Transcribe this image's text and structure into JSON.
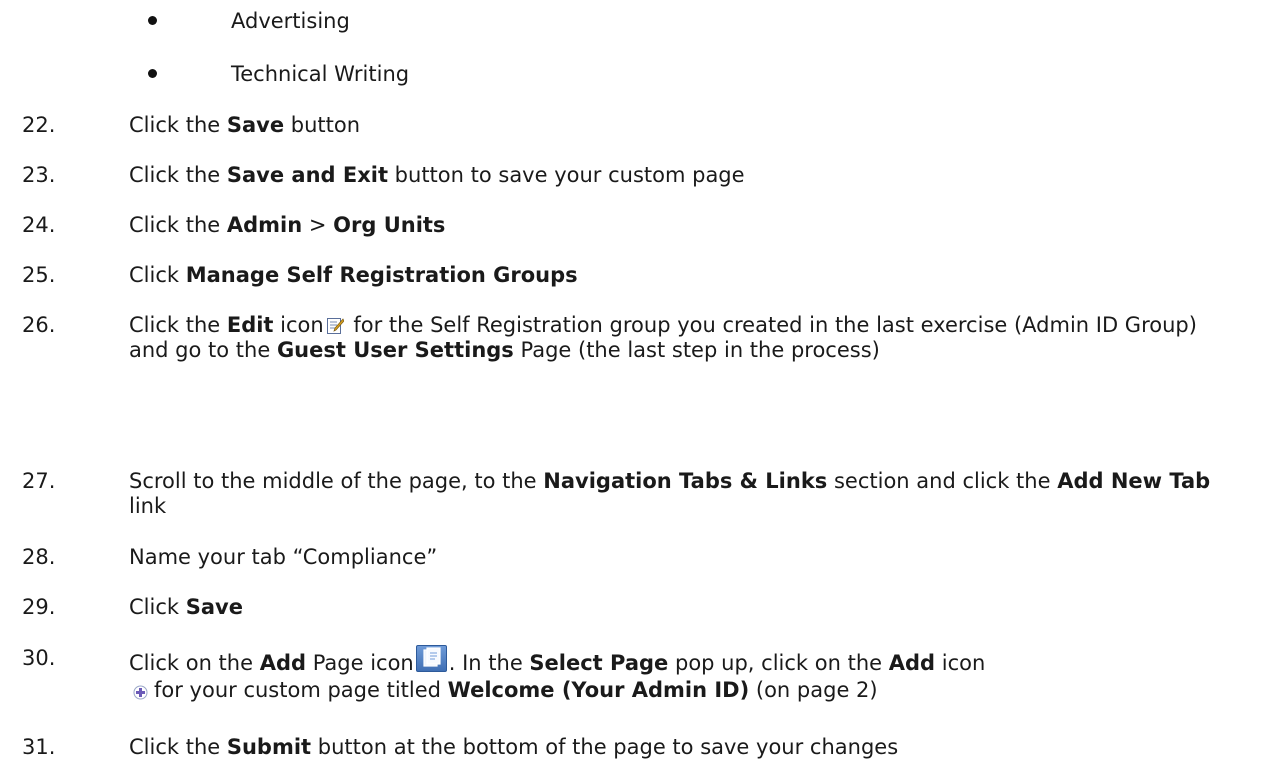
{
  "bullets": [
    "Advertising",
    "Technical Writing"
  ],
  "steps": [
    {
      "num": "22.",
      "p": [
        "Click the ",
        "Save",
        " button"
      ]
    },
    {
      "num": "23.",
      "p": [
        "Click the ",
        "Save and Exit",
        " button to save your custom page"
      ]
    },
    {
      "num": "24.",
      "p": [
        "Click the ",
        "Admin",
        " > ",
        "Org Units"
      ]
    },
    {
      "num": "25.",
      "p": [
        "Click ",
        "Manage Self Registration Groups"
      ]
    },
    {
      "num": "26.",
      "p": [
        "Click the ",
        "Edit",
        " icon",
        " for the Self Registration group you created in the last exercise (Admin ID Group) and go to the ",
        "Guest User Settings",
        " Page (the last step in the process)"
      ]
    },
    {
      "num": "27.",
      "p": [
        "Scroll to the middle of the page, to the ",
        "Navigation Tabs & Links",
        " section and click the ",
        "Add New Tab",
        " link"
      ]
    },
    {
      "num": "28.",
      "p": [
        "Name your tab “Compliance”"
      ]
    },
    {
      "num": "29.",
      "p": [
        "Click ",
        "Save"
      ]
    },
    {
      "num": "30.",
      "p": [
        "Click on the ",
        "Add",
        " Page icon",
        ". In the ",
        "Select Page",
        " pop up, click on the ",
        "Add",
        " icon",
        "for your custom page titled ",
        "Welcome (Your Admin ID)",
        " (on page 2)"
      ]
    },
    {
      "num": "31.",
      "p": [
        "Click the ",
        "Submit",
        " button at the bottom of the page to save your changes"
      ]
    }
  ],
  "icons": {
    "edit": "edit-pencil-icon",
    "add_page": "add-page-icon",
    "add": "add-plus-icon"
  }
}
